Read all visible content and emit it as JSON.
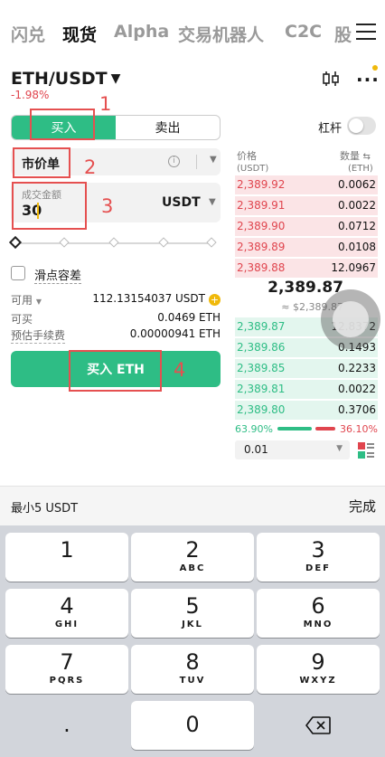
{
  "nav": {
    "tabs": [
      "闪兑",
      "现货",
      "Alpha",
      "交易机器人",
      "C2C",
      "股"
    ],
    "active_index": 1
  },
  "pair": {
    "symbol": "ETH/USDT",
    "change": "-1.98%"
  },
  "order": {
    "buy_label": "买入",
    "sell_label": "卖出",
    "leverage_label": "杠杆",
    "type_label": "市价单",
    "amount_label": "成交金额",
    "amount_value": "30",
    "amount_unit": "USDT",
    "slippage_label": "滑点容差",
    "available_label": "可用",
    "available_value": "112.13154037 USDT",
    "can_buy_label": "可买",
    "can_buy_value": "0.0469 ETH",
    "fee_label": "预估手续费",
    "fee_value": "0.00000941 ETH",
    "submit_label": "买入 ETH"
  },
  "annotations": [
    "1",
    "2",
    "3",
    "4"
  ],
  "orderbook": {
    "price_header": "价格",
    "price_unit": "(USDT)",
    "qty_header": "数量",
    "qty_unit": "(ETH)",
    "asks": [
      {
        "price": "2,389.92",
        "qty": "0.0062"
      },
      {
        "price": "2,389.91",
        "qty": "0.0022"
      },
      {
        "price": "2,389.90",
        "qty": "0.0712"
      },
      {
        "price": "2,389.89",
        "qty": "0.0108"
      },
      {
        "price": "2,389.88",
        "qty": "12.0967"
      }
    ],
    "mid_price": "2,389.87",
    "mid_usd": "≈ $2,389.87",
    "bids": [
      {
        "price": "2,389.87",
        "qty": "12.8372"
      },
      {
        "price": "2,389.86",
        "qty": "0.1493"
      },
      {
        "price": "2,389.85",
        "qty": "0.2233"
      },
      {
        "price": "2,389.81",
        "qty": "0.0022"
      },
      {
        "price": "2,389.80",
        "qty": "0.3706"
      }
    ],
    "buy_ratio": "63.90%",
    "sell_ratio": "36.10%",
    "depth": "0.01"
  },
  "keyboard": {
    "hint": "最小5 USDT",
    "done": "完成",
    "keys": [
      {
        "n": "1",
        "l": ""
      },
      {
        "n": "2",
        "l": "ABC"
      },
      {
        "n": "3",
        "l": "DEF"
      },
      {
        "n": "4",
        "l": "GHI"
      },
      {
        "n": "5",
        "l": "JKL"
      },
      {
        "n": "6",
        "l": "MNO"
      },
      {
        "n": "7",
        "l": "PQRS"
      },
      {
        "n": "8",
        "l": "TUV"
      },
      {
        "n": "9",
        "l": "WXYZ"
      },
      {
        "n": ".",
        "l": ""
      },
      {
        "n": "0",
        "l": ""
      }
    ]
  },
  "colors": {
    "buy_green": "#2ebd85",
    "sell_red": "#e0454e",
    "accent_yellow": "#f0b90b",
    "annotation_red": "#e55050"
  }
}
